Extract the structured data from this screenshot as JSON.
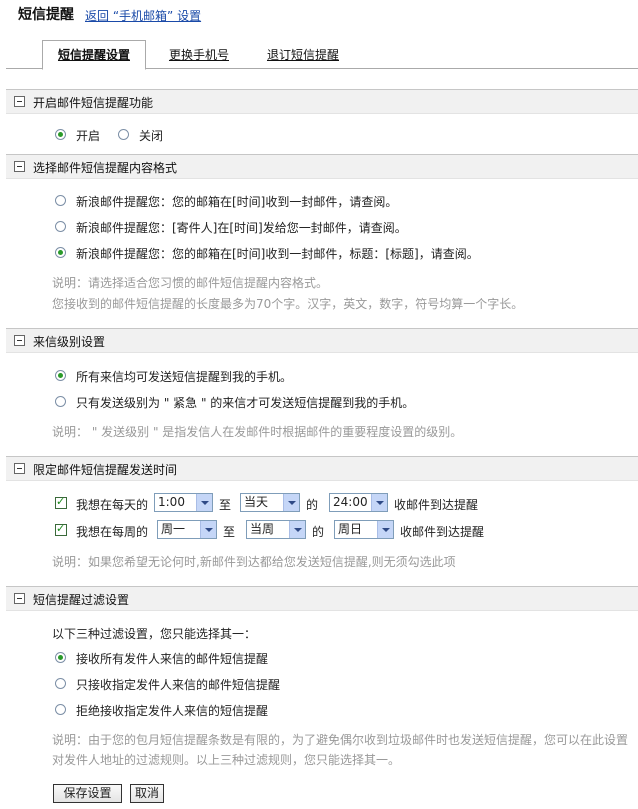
{
  "header": {
    "title": "短信提醒",
    "back_link": "返回 “手机邮箱” 设置"
  },
  "tabs": [
    {
      "label": "短信提醒设置",
      "active": true
    },
    {
      "label": "更换手机号",
      "active": false
    },
    {
      "label": "退订短信提醒",
      "active": false
    }
  ],
  "section1": {
    "title": "开启邮件短信提醒功能",
    "options": [
      "开启",
      "关闭"
    ],
    "selected": 0
  },
  "section2": {
    "title": "选择邮件短信提醒内容格式",
    "options": [
      "新浪邮件提醒您：您的邮箱在[时间]收到一封邮件，请查阅。",
      "新浪邮件提醒您：[寄件人]在[时间]发给您一封邮件，请查阅。",
      "新浪邮件提醒您：您的邮箱在[时间]收到一封邮件，标题：[标题]，请查阅。"
    ],
    "selected": 2,
    "note1": "说明：请选择适合您习惯的邮件短信提醒内容格式。",
    "note2": "您接收到的邮件短信提醒的长度最多为70个字。汉字，英文，数字，符号均算一个字长。"
  },
  "section3": {
    "title": "来信级别设置",
    "options": [
      "所有来信均可发送短信提醒到我的手机。",
      "只有发送级别为 \" 紧急 \" 的来信才可发送短信提醒到我的手机。"
    ],
    "selected": 0,
    "note": "说明： \" 发送级别 \" 是指发信人在发邮件时根据邮件的重要程度设置的级别。"
  },
  "section4": {
    "title": "限定邮件短信提醒发送时间",
    "row1": {
      "label": "我想在每天的",
      "from": "1:00",
      "to_word": "至",
      "to_day": "当天",
      "of_word": "的",
      "to_time": "24:00",
      "suffix": "收邮件到达提醒",
      "checked": true
    },
    "row2": {
      "label": "我想在每周的",
      "from": "周一",
      "to_word": "至",
      "to_week": "当周",
      "of_word": "的",
      "to_day": "周日",
      "suffix": "收邮件到达提醒",
      "checked": true
    },
    "note": "说明：如果您希望无论何时,新邮件到达都给您发送短信提醒,则无须勾选此项"
  },
  "section5": {
    "title": "短信提醒过滤设置",
    "intro": "以下三种过滤设置，您只能选择其一：",
    "options": [
      "接收所有发件人来信的邮件短信提醒",
      "只接收指定发件人来信的邮件短信提醒",
      "拒绝接收指定发件人来信的短信提醒"
    ],
    "selected": 0,
    "note1": "说明：由于您的包月短信提醒条数是有限的，为了避免偶尔收到垃圾邮件时也发送短信提醒，您可以在此设置",
    "note2": "对发件人地址的过滤规则。以上三种过滤规则，您只能选择其一。"
  },
  "buttons": {
    "save": "保存设置",
    "cancel": "取消"
  }
}
